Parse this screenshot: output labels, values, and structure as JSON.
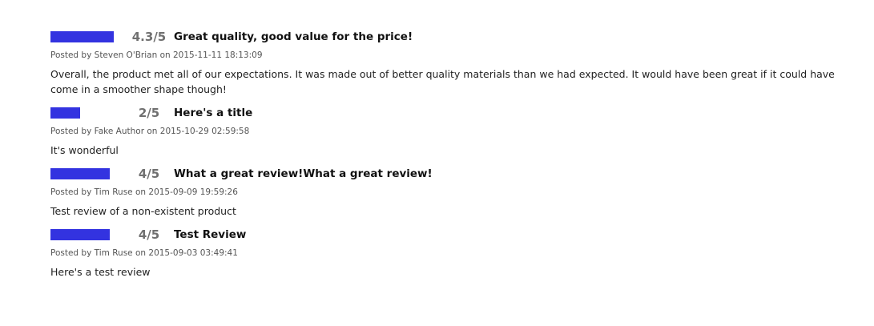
{
  "reviews": [
    {
      "rating": 4.3,
      "max_rating": 5,
      "score_label": "4.3/5",
      "title": "Great quality, good value for the price!",
      "meta": "Posted by Steven O'Brian on 2015-11-11 18:13:09",
      "body": "Overall, the product met all of our expectations. It was made out of better quality materials than we had expected. It would have been great if it could have come in a smoother shape though!"
    },
    {
      "rating": 2,
      "max_rating": 5,
      "score_label": "2/5",
      "title": "Here's a title",
      "meta": "Posted by Fake Author on 2015-10-29 02:59:58",
      "body": "It's wonderful"
    },
    {
      "rating": 4,
      "max_rating": 5,
      "score_label": "4/5",
      "title": "What a great review!What a great review!",
      "meta": "Posted by Tim Ruse on 2015-09-09 19:59:26",
      "body": "Test review of a non-existent product"
    },
    {
      "rating": 4,
      "max_rating": 5,
      "score_label": "4/5",
      "title": "Test Review",
      "meta": "Posted by Tim Ruse on 2015-09-03 03:49:41",
      "body": "Here's a test review"
    }
  ],
  "colors": {
    "rating_fill": "#3333e0",
    "score_text": "#707070"
  }
}
